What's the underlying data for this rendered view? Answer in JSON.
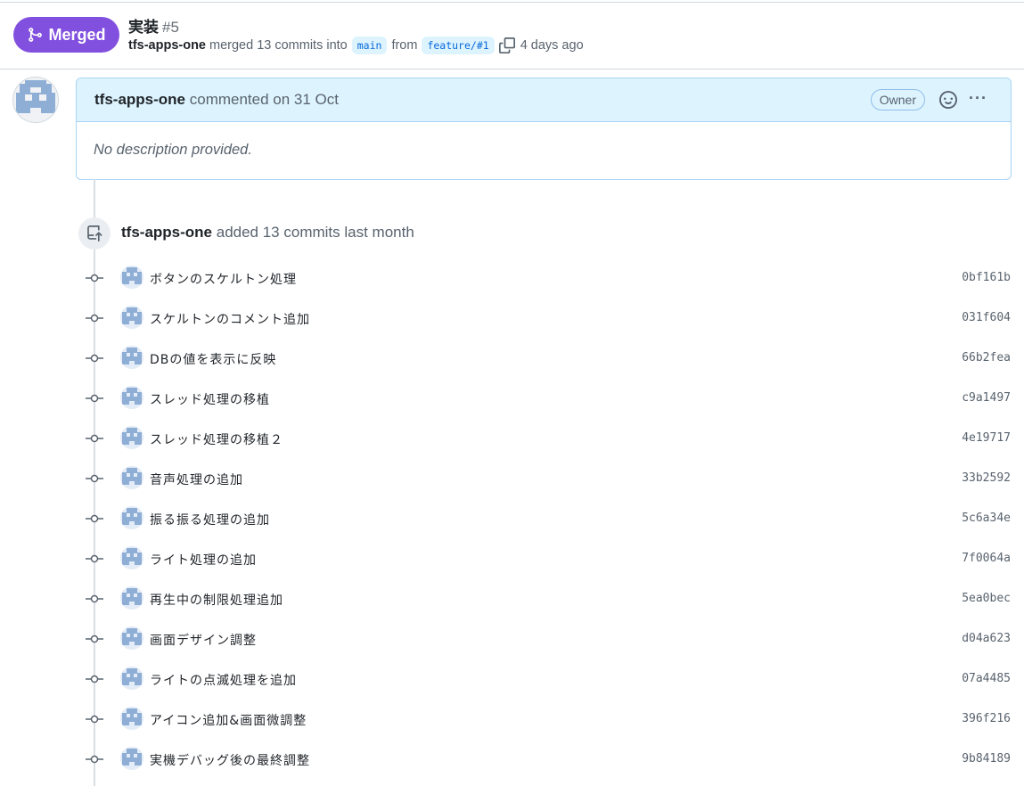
{
  "pr": {
    "status": "Merged",
    "title": "実装",
    "number": "#5",
    "author": "tfs-apps-one",
    "merged_text": "merged 13 commits into",
    "base_branch": "main",
    "from_text": "from",
    "head_branch": "feature/#1",
    "time": "4 days ago"
  },
  "comment": {
    "author": "tfs-apps-one",
    "action": "commented on 31 Oct",
    "badge": "Owner",
    "body": "No description provided."
  },
  "event": {
    "author": "tfs-apps-one",
    "text": "added 13 commits last month"
  },
  "commits": [
    {
      "message": "ボタンのスケルトン処理",
      "sha": "0bf161b"
    },
    {
      "message": "スケルトンのコメント追加",
      "sha": "031f604"
    },
    {
      "message": "DBの値を表示に反映",
      "sha": "66b2fea"
    },
    {
      "message": "スレッド処理の移植",
      "sha": "c9a1497"
    },
    {
      "message": "スレッド処理の移植２",
      "sha": "4e19717"
    },
    {
      "message": "音声処理の追加",
      "sha": "33b2592"
    },
    {
      "message": "振る振る処理の追加",
      "sha": "5c6a34e"
    },
    {
      "message": "ライト処理の追加",
      "sha": "7f0064a"
    },
    {
      "message": "再生中の制限処理追加",
      "sha": "5ea0bec"
    },
    {
      "message": "画面デザイン調整",
      "sha": "d04a623"
    },
    {
      "message": "ライトの点滅処理を追加",
      "sha": "07a4485"
    },
    {
      "message": "アイコン追加&画面微調整",
      "sha": "396f216"
    },
    {
      "message": "実機デバッグ後の最終調整",
      "sha": "9b84189"
    }
  ],
  "colors": {
    "merged": "#8250df",
    "branch_bg": "#ddf4ff",
    "branch_text": "#0969da",
    "comment_header": "#ddf4ff"
  },
  "icons": [
    "git-merge-icon",
    "copy-icon",
    "smiley-icon",
    "kebab-icon",
    "repo-push-icon",
    "git-commit-icon"
  ]
}
